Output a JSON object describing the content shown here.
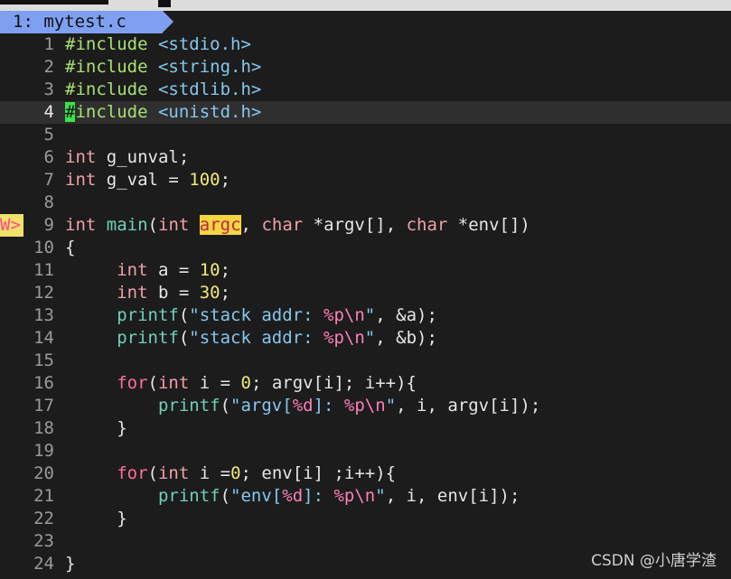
{
  "tab": {
    "label": "1: mytest.c"
  },
  "sign_marker": "W>",
  "lines": [
    {
      "n": "1",
      "t": "#include <stdio.h>"
    },
    {
      "n": "2",
      "t": "#include <string.h>"
    },
    {
      "n": "3",
      "t": "#include <stdlib.h>"
    },
    {
      "n": "4",
      "t": "#include <unistd.h>"
    },
    {
      "n": "5",
      "t": ""
    },
    {
      "n": "6",
      "t": "int g_unval;"
    },
    {
      "n": "7",
      "t": "int g_val = 100;"
    },
    {
      "n": "8",
      "t": ""
    },
    {
      "n": "9",
      "t": "int main(int argc, char *argv[], char *env[])"
    },
    {
      "n": "10",
      "t": "{"
    },
    {
      "n": "11",
      "t": "     int a = 10;"
    },
    {
      "n": "12",
      "t": "     int b = 30;"
    },
    {
      "n": "13",
      "t": "     printf(\"stack addr: %p\\n\", &a);"
    },
    {
      "n": "14",
      "t": "     printf(\"stack addr: %p\\n\", &b);"
    },
    {
      "n": "15",
      "t": ""
    },
    {
      "n": "16",
      "t": "     for(int i = 0; argv[i]; i++){"
    },
    {
      "n": "17",
      "t": "         printf(\"argv[%d]: %p\\n\", i, argv[i]);"
    },
    {
      "n": "18",
      "t": "     }"
    },
    {
      "n": "19",
      "t": ""
    },
    {
      "n": "20",
      "t": "     for(int i =0; env[i] ;i++){"
    },
    {
      "n": "21",
      "t": "         printf(\"env[%d]: %p\\n\", i, env[i]);"
    },
    {
      "n": "22",
      "t": "     }"
    },
    {
      "n": "23",
      "t": ""
    },
    {
      "n": "24",
      "t": "}"
    }
  ],
  "watermark": "CSDN @小唐学渣",
  "colors": {
    "background": "#1c1c1c",
    "tab": "#7fa0f0",
    "keyword": "#f0a0a8",
    "preprocessor": "#a8e070",
    "function": "#70d0b8",
    "string": "#86c7ee",
    "format": "#ff7fb8",
    "number": "#f0e878",
    "highlight": "#f5d63f",
    "cursor": "#39e34a"
  }
}
